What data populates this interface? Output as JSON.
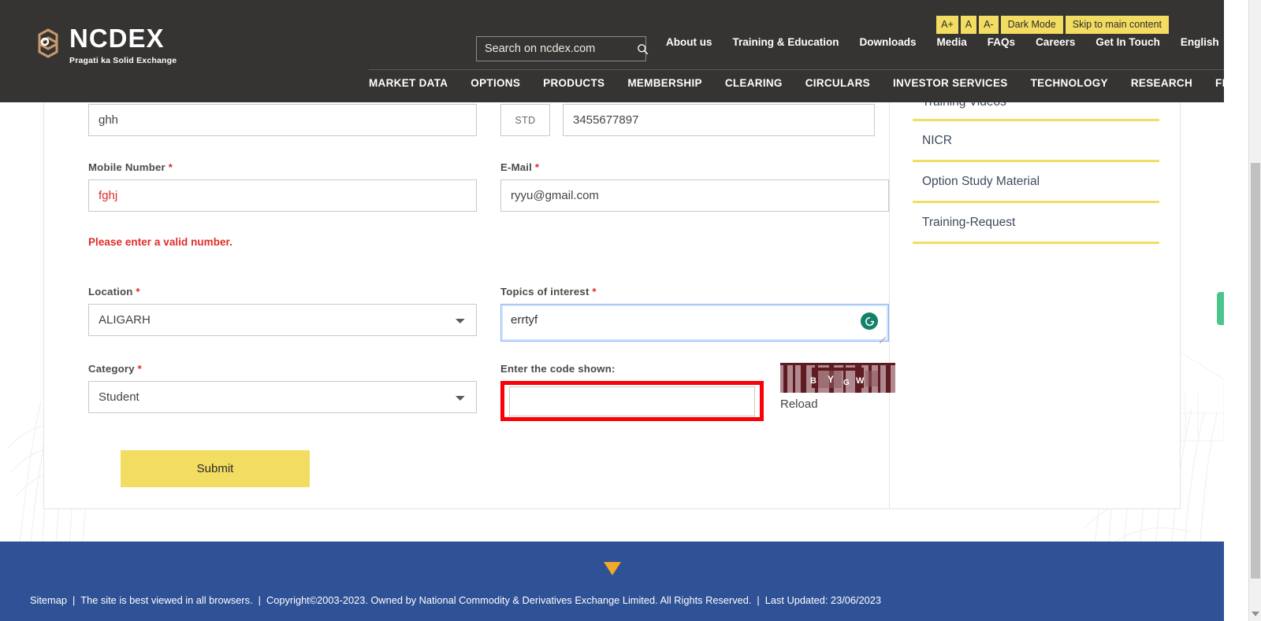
{
  "header": {
    "logo": {
      "title": "NCDEX",
      "tagline": "Pragati ka Solid Exchange"
    },
    "search": {
      "placeholder": "Search on ncdex.com",
      "value": "",
      "icon": "search-icon"
    },
    "accessibility": [
      {
        "label": "A+",
        "name": "font-increase"
      },
      {
        "label": "A",
        "name": "font-normal"
      },
      {
        "label": "A-",
        "name": "font-decrease"
      },
      {
        "label": "Dark Mode",
        "name": "dark-mode"
      },
      {
        "label": "Skip to main content",
        "name": "skip-to-main"
      }
    ],
    "utility_nav": [
      "About us",
      "Training & Education",
      "Downloads",
      "Media",
      "FAQs",
      "Careers",
      "Get In Touch"
    ],
    "language": "English",
    "main_nav": [
      "MARKET DATA",
      "OPTIONS",
      "PRODUCTS",
      "MEMBERSHIP",
      "CLEARING",
      "CIRCULARS",
      "INVESTOR SERVICES",
      "TECHNOLOGY",
      "RESEARCH",
      "FPO"
    ]
  },
  "form": {
    "name_field": {
      "value": "ghh"
    },
    "std": {
      "label": "STD",
      "phone_value": "3455677897"
    },
    "mobile": {
      "label": "Mobile Number",
      "required": "*",
      "value": "fghj",
      "error": "Please enter a valid number."
    },
    "email": {
      "label": "E-Mail",
      "required": "*",
      "value": "ryyu@gmail.com"
    },
    "location": {
      "label": "Location",
      "required": "*",
      "value": "ALIGARH"
    },
    "topics": {
      "label": "Topics of interest",
      "required": "*",
      "value": "errtyf"
    },
    "category": {
      "label": "Category",
      "required": "*",
      "value": "Student"
    },
    "captcha": {
      "label": "Enter the code shown:",
      "value": "",
      "reload_label": "Reload",
      "code_chars": [
        "B",
        "Y",
        "G",
        "W"
      ]
    },
    "submit_label": "Submit"
  },
  "sidebar": {
    "items": [
      {
        "label": "Training Videos"
      },
      {
        "label": "NICR"
      },
      {
        "label": "Option Study Material"
      },
      {
        "label": "Training-Request"
      }
    ]
  },
  "footer": {
    "sitemap": "Sitemap",
    "sep": "|",
    "browsers": "The site is best viewed in all browsers.",
    "copyright": "Copyright©2003-2023. Owned by National Commodity & Derivatives Exchange Limited. All Rights Reserved.",
    "last_updated": "Last Updated: 23/06/2023"
  },
  "colors": {
    "header_bg": "#363432",
    "accent_yellow": "#f3dc62",
    "footer_blue": "#2f5196",
    "error_red": "#e02b27",
    "highlight_red": "#fb0007",
    "feedback_green": "#4cc58c"
  }
}
